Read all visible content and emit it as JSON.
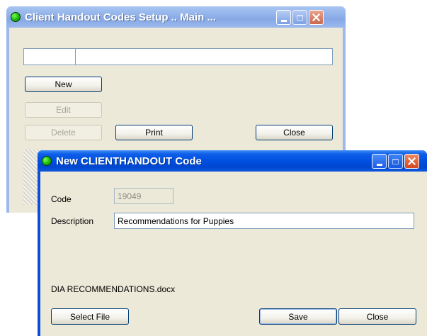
{
  "main_window": {
    "title": "Client Handout Codes Setup .. Main ...",
    "buttons": {
      "new": "New",
      "edit": "Edit",
      "delete": "Delete",
      "print": "Print",
      "close": "Close"
    },
    "filter": {
      "left_value": "",
      "right_value": ""
    }
  },
  "dialog": {
    "title": "New CLIENTHANDOUT Code",
    "code_label": "Code",
    "code_value": "19049",
    "description_label": "Description",
    "description_value": "Recommendations for Puppies",
    "file_name": "DIA RECOMMENDATIONS.docx",
    "buttons": {
      "select_file": "Select File",
      "save": "Save",
      "close": "Close"
    }
  },
  "icons": {
    "status": "green-status-icon",
    "minimize": "minimize-icon",
    "maximize": "maximize-icon",
    "close": "close-icon"
  },
  "colors": {
    "active_title": "#0050e0",
    "inactive_title": "#8fb0ea",
    "window_bg": "#ece9d8",
    "close_red": "#d5461e"
  }
}
